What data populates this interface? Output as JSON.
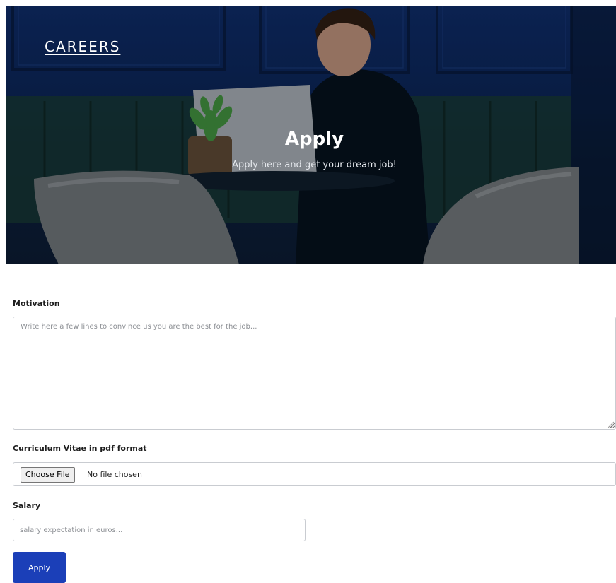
{
  "header": {
    "brand": "CAREERS",
    "title": "Apply",
    "subtitle": "Apply here and get your dream job!"
  },
  "form": {
    "motivation": {
      "label": "Motivation",
      "placeholder": "Write here a few lines to convince us you are the best for the job..."
    },
    "cv": {
      "label": "Curriculum Vitae in pdf format",
      "button_label": "Choose File",
      "status": "No file chosen"
    },
    "salary": {
      "label": "Salary",
      "placeholder": "salary expectation in euros..."
    },
    "submit_label": "Apply"
  },
  "colors": {
    "hero_navy": "#0b2352",
    "primary_button": "#1b3fb8"
  }
}
